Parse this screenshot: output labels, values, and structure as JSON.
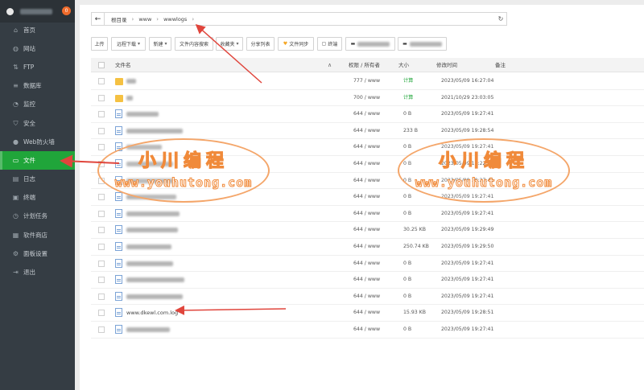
{
  "sidebar": {
    "badge": "0",
    "items": [
      {
        "label": "首页",
        "icon": "home-icon",
        "glyph": "⌂"
      },
      {
        "label": "网站",
        "icon": "globe-icon",
        "glyph": "◍"
      },
      {
        "label": "FTP",
        "icon": "ftp-icon",
        "glyph": "⇅"
      },
      {
        "label": "数据库",
        "icon": "database-icon",
        "glyph": "≡"
      },
      {
        "label": "监控",
        "icon": "monitor-icon",
        "glyph": "◔"
      },
      {
        "label": "安全",
        "icon": "shield-icon",
        "glyph": "⛉"
      },
      {
        "label": "Web防火墙",
        "icon": "firewall-icon",
        "glyph": "●"
      },
      {
        "label": "文件",
        "icon": "folder-icon",
        "glyph": "▭"
      },
      {
        "label": "日志",
        "icon": "log-icon",
        "glyph": "▤"
      },
      {
        "label": "终端",
        "icon": "terminal-icon",
        "glyph": "▣"
      },
      {
        "label": "计划任务",
        "icon": "clock-icon",
        "glyph": "◷"
      },
      {
        "label": "软件商店",
        "icon": "store-icon",
        "glyph": "▦"
      },
      {
        "label": "面板设置",
        "icon": "settings-icon",
        "glyph": "⚙"
      },
      {
        "label": "退出",
        "icon": "logout-icon",
        "glyph": "⇥"
      }
    ]
  },
  "address": {
    "back_glyph": "←",
    "crumbs": [
      "根目录",
      "www",
      "wwwlogs"
    ],
    "sep": "›",
    "refresh_glyph": "↻"
  },
  "toolbar": {
    "upload": "上传",
    "remote_download": "远程下载",
    "new": "新建",
    "file_search": "文件内容搜索",
    "favorites": "收藏夹",
    "share_list": "分享列表",
    "file_sync": "文件同步",
    "terminal": "终端",
    "dropdown_glyph": "▾"
  },
  "table": {
    "headers": {
      "name": "文件名",
      "perm": "权限 / 所有者",
      "size": "大小",
      "mtime": "修改时间",
      "note": "备注"
    },
    "sort_glyph": "∧",
    "rows": [
      {
        "type": "folder",
        "name": "",
        "perm": "777 / www",
        "size": "计算",
        "mtime": "2023/05/09 16:27:04",
        "calc": true
      },
      {
        "type": "folder",
        "name": "",
        "perm": "700 / www",
        "size": "计算",
        "mtime": "2021/10/29 23:03:05",
        "calc": true
      },
      {
        "type": "file",
        "name": "",
        "perm": "644 / www",
        "size": "0 B",
        "mtime": "2023/05/09 19:27:41"
      },
      {
        "type": "file",
        "name": "",
        "perm": "644 / www",
        "size": "233 B",
        "mtime": "2023/05/09 19:28:54"
      },
      {
        "type": "file",
        "name": "",
        "perm": "644 / www",
        "size": "0 B",
        "mtime": "2023/05/09 19:27:41"
      },
      {
        "type": "file",
        "name": "",
        "perm": "644 / www",
        "size": "0 B",
        "mtime": "2023/05/09 19:22:41"
      },
      {
        "type": "file",
        "name": "",
        "perm": "644 / www",
        "size": "0 B",
        "mtime": "2023/05/09 19:27:41"
      },
      {
        "type": "file",
        "name": "",
        "perm": "644 / www",
        "size": "0 B",
        "mtime": "2023/05/09 19:27:41"
      },
      {
        "type": "file",
        "name": "",
        "perm": "644 / www",
        "size": "0 B",
        "mtime": "2023/05/09 19:27:41"
      },
      {
        "type": "file",
        "name": "",
        "perm": "644 / www",
        "size": "30.25 KB",
        "mtime": "2023/05/09 19:29:49"
      },
      {
        "type": "file",
        "name": "",
        "perm": "644 / www",
        "size": "250.74 KB",
        "mtime": "2023/05/09 19:29:50"
      },
      {
        "type": "file",
        "name": "",
        "perm": "644 / www",
        "size": "0 B",
        "mtime": "2023/05/09 19:27:41"
      },
      {
        "type": "file",
        "name": "",
        "perm": "644 / www",
        "size": "0 B",
        "mtime": "2023/05/09 19:27:41"
      },
      {
        "type": "file",
        "name": "",
        "perm": "644 / www",
        "size": "0 B",
        "mtime": "2023/05/09 19:27:41"
      },
      {
        "type": "file",
        "name": "www.dkewl.com.log",
        "perm": "644 / www",
        "size": "15.93 KB",
        "mtime": "2023/05/09 19:28:51"
      },
      {
        "type": "file",
        "name": "",
        "perm": "644 / www",
        "size": "0 B",
        "mtime": "2023/05/09 19:27:41"
      }
    ]
  },
  "watermark": {
    "text": "小川编程",
    "url": "www.youhutong.com",
    "color": "#f08a3a"
  },
  "colors": {
    "sidebar_bg": "#353d44",
    "active": "#20a53a",
    "badge": "#ef6b2b",
    "arrow": "#e0453c"
  }
}
